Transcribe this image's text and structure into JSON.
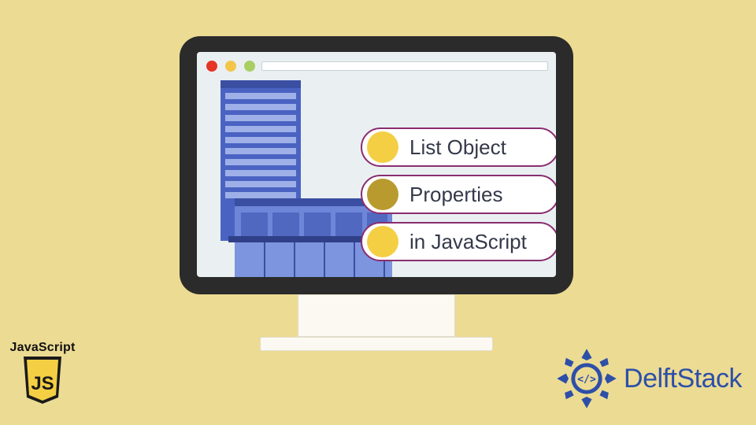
{
  "pills": [
    {
      "label": "List Object"
    },
    {
      "label": "Properties"
    },
    {
      "label": "in JavaScript"
    }
  ],
  "js_badge": {
    "label": "JavaScript",
    "initials": "JS"
  },
  "delftstack": {
    "name": "DelftStack",
    "glyph": "</>"
  },
  "colors": {
    "background": "#ecdb93",
    "pill_border": "#8a2d6f",
    "bullet_primary": "#f4cf44",
    "bullet_alt": "#b89a2e",
    "delft_blue": "#2d4fa8"
  }
}
